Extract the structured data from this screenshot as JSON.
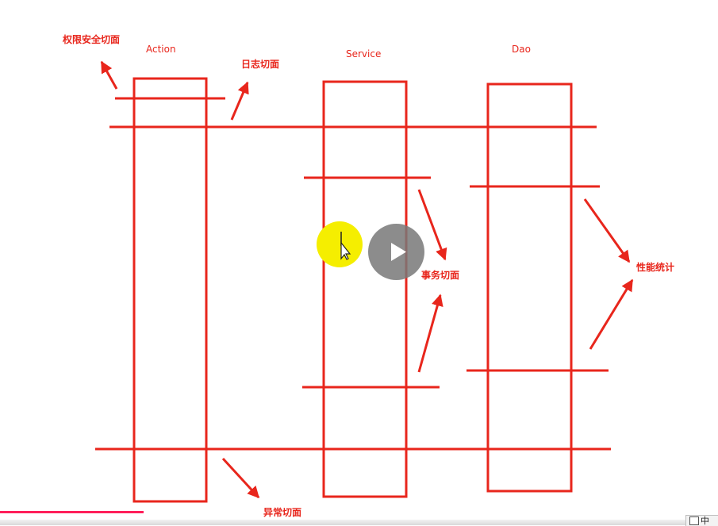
{
  "diagram": {
    "layers": {
      "action": "Action",
      "service": "Service",
      "dao": "Dao"
    },
    "aspects": {
      "security": "权限安全切面",
      "log": "日志切面",
      "transaction": "事务切面",
      "performance": "性能统计",
      "exception": "异常切面"
    },
    "line_color": "#e8261c"
  },
  "player": {
    "play_icon": "play-icon",
    "progress_fraction": 0.2,
    "progress_color": "#ff1f5a"
  },
  "taskbar": {
    "ime_label": "中"
  }
}
